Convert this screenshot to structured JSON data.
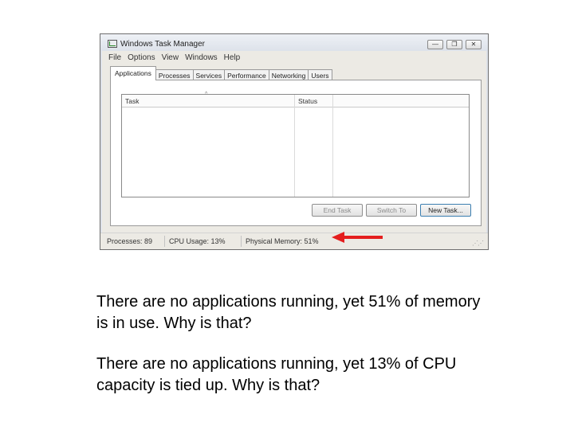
{
  "window": {
    "title": "Windows Task Manager",
    "controls": {
      "minimize": "—",
      "restore": "❐",
      "close": "✕"
    }
  },
  "menu": [
    "File",
    "Options",
    "View",
    "Windows",
    "Help"
  ],
  "tabs": [
    "Applications",
    "Processes",
    "Services",
    "Performance",
    "Networking",
    "Users"
  ],
  "active_tab": "Applications",
  "task_list": {
    "columns": [
      "Task",
      "Status"
    ],
    "rows": []
  },
  "buttons": {
    "end_task": "End Task",
    "switch_to": "Switch To",
    "new_task": "New Task..."
  },
  "status_bar": {
    "processes": "Processes: 89",
    "cpu_usage": "CPU Usage: 13%",
    "physical_memory": "Physical Memory: 51%"
  },
  "annotation": {
    "arrow_color": "#e41e1e"
  },
  "captions": [
    "There are no applications running, yet 51% of memory is in use.  Why is that?",
    "There are no applications running, yet 13% of CPU capacity is tied up. Why is that?"
  ]
}
